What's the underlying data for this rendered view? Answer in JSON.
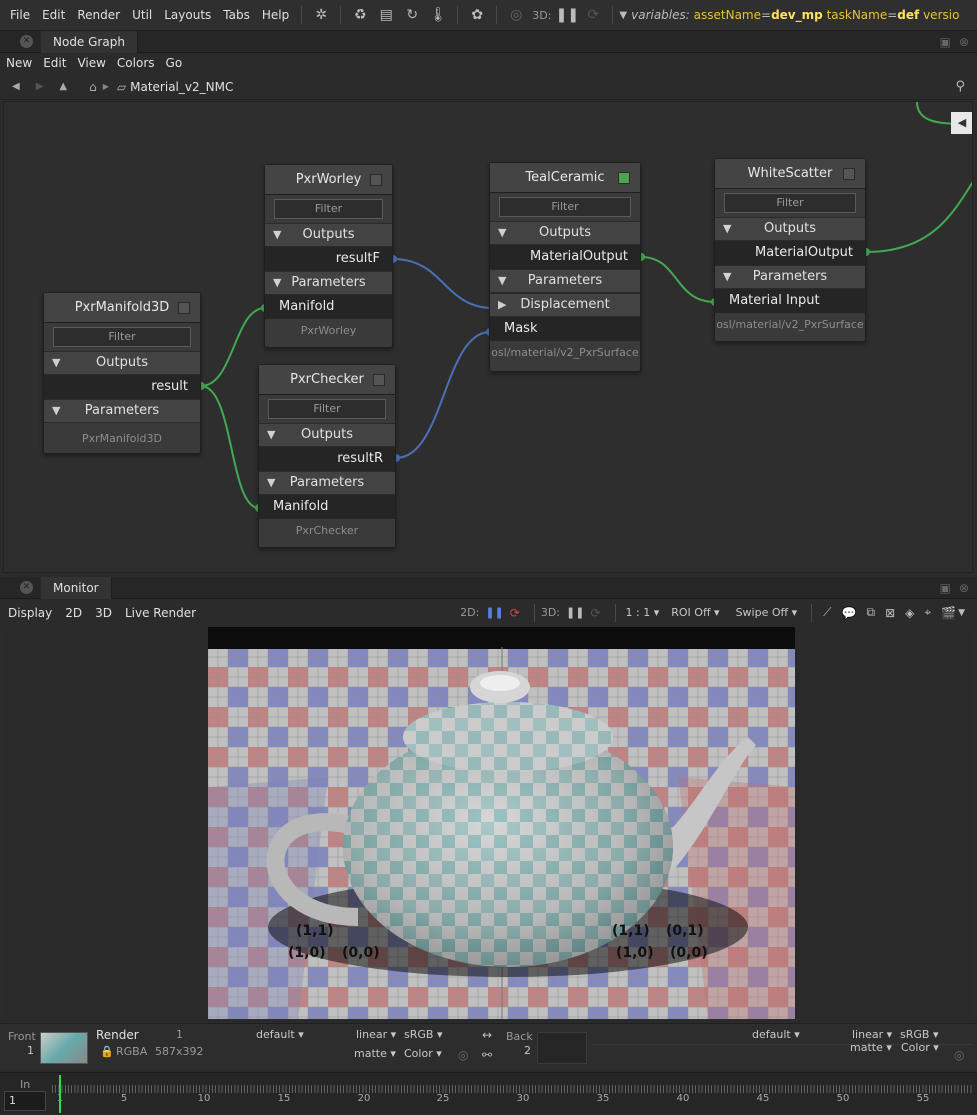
{
  "menubar": {
    "items": [
      "File",
      "Edit",
      "Render",
      "Util",
      "Layouts",
      "Tabs",
      "Help"
    ],
    "mode_3d_label": "3D:",
    "variables_label": "variables:",
    "var1_key": "assetName",
    "var1_value": "dev_mp",
    "var2_key": "taskName",
    "var2_value": "def",
    "var3_partial": "versio"
  },
  "node_graph_panel": {
    "tab_label": "Node Graph",
    "menu": [
      "New",
      "Edit",
      "View",
      "Colors",
      "Go"
    ],
    "breadcrumb": "Material_v2_NMC"
  },
  "nodes": {
    "manifold3d": {
      "title": "PxrManifold3D",
      "filter": "Filter",
      "outputs": "Outputs",
      "out_port": "result",
      "parameters": "Parameters",
      "footer": "PxrManifold3D"
    },
    "worley": {
      "title": "PxrWorley",
      "filter": "Filter",
      "outputs": "Outputs",
      "out_port": "resultF",
      "parameters": "Parameters",
      "in_port": "Manifold",
      "footer": "PxrWorley"
    },
    "checker": {
      "title": "PxrChecker",
      "filter": "Filter",
      "outputs": "Outputs",
      "out_port": "resultR",
      "parameters": "Parameters",
      "in_port": "Manifold",
      "footer": "PxrChecker"
    },
    "teal": {
      "title": "TealCeramic",
      "filter": "Filter",
      "outputs": "Outputs",
      "out_port": "MaterialOutput",
      "parameters": "Parameters",
      "disp": "Displacement",
      "in_port": "Mask",
      "footer": "osl/material/v2_PxrSurface"
    },
    "white": {
      "title": "WhiteScatter",
      "filter": "Filter",
      "outputs": "Outputs",
      "out_port": "MaterialOutput",
      "parameters": "Parameters",
      "in_port": "Material Input",
      "footer": "osl/material/v2_PxrSurface"
    }
  },
  "monitor_panel": {
    "tab_label": "Monitor",
    "toolbar": [
      "Display",
      "2D",
      "3D",
      "Live Render"
    ],
    "mode_2d_label": "2D:",
    "mode_3d_label": "3D:",
    "ratio": "1 : 1",
    "roi": "ROI Off",
    "swipe": "Swipe Off"
  },
  "render_image": {
    "uv_labels_left": [
      "(1,1)",
      "(1,0)",
      "(0,0)"
    ],
    "uv_labels_right": [
      "(1,1)",
      "(0,1)",
      "(1,0)",
      "(0,0)"
    ]
  },
  "monitor_info": {
    "front_label": "Front",
    "front_index": "1",
    "render_label": "Render",
    "render_index": "1",
    "channels": "RGBA",
    "resolution": "587x392",
    "lut_default": "default",
    "linear": "linear",
    "srgb": "sRGB",
    "matte": "matte",
    "color": "Color",
    "back_label": "Back",
    "back_index": "2"
  },
  "timeline": {
    "in_label": "In",
    "frame_field": "1",
    "ticks": [
      "1",
      "5",
      "10",
      "15",
      "20",
      "25",
      "30",
      "35",
      "40",
      "45",
      "50",
      "55"
    ]
  }
}
